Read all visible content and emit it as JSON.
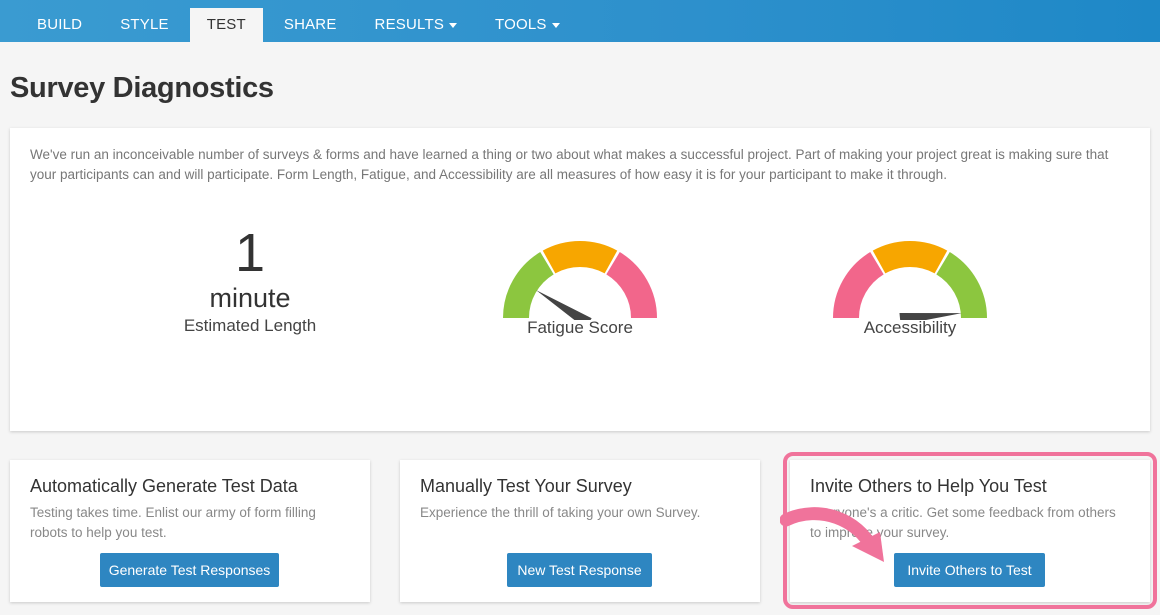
{
  "nav": {
    "tabs": [
      {
        "label": "BUILD"
      },
      {
        "label": "STYLE"
      },
      {
        "label": "TEST"
      },
      {
        "label": "SHARE"
      },
      {
        "label": "RESULTS"
      },
      {
        "label": "TOOLS"
      }
    ],
    "active": "TEST"
  },
  "page": {
    "title": "Survey Diagnostics"
  },
  "diagnostics": {
    "intro": "We've run an inconceivable number of surveys & forms and have learned a thing or two about what makes a successful project. Part of making your project great is making sure that your participants can and will participate. Form Length, Fatigue, and Accessibility are all measures of how easy it is for your participant to make it through.",
    "length": {
      "value": "1",
      "unit": "minute",
      "label": "Estimated Length"
    },
    "fatigue": {
      "label": "Fatigue Score",
      "level": 0.18,
      "colors": [
        "#8cc63f",
        "#f7a600",
        "#f2668b"
      ]
    },
    "accessibility": {
      "label": "Accessibility",
      "level": 0.97,
      "colors": [
        "#f2668b",
        "#f7a600",
        "#8cc63f"
      ]
    }
  },
  "actions": [
    {
      "title": "Automatically Generate Test Data",
      "desc": "Testing takes time. Enlist our army of form filling robots to help you test.",
      "button": "Generate Test Responses"
    },
    {
      "title": "Manually Test Your Survey",
      "desc": "Experience the thrill of taking your own Survey.",
      "button": "New Test Response"
    },
    {
      "title": "Invite Others to Help You Test",
      "desc": "Everyone's a critic. Get some feedback from others to improve your survey.",
      "button": "Invite Others to Test"
    }
  ],
  "annotation": {
    "color": "#f0739b"
  }
}
